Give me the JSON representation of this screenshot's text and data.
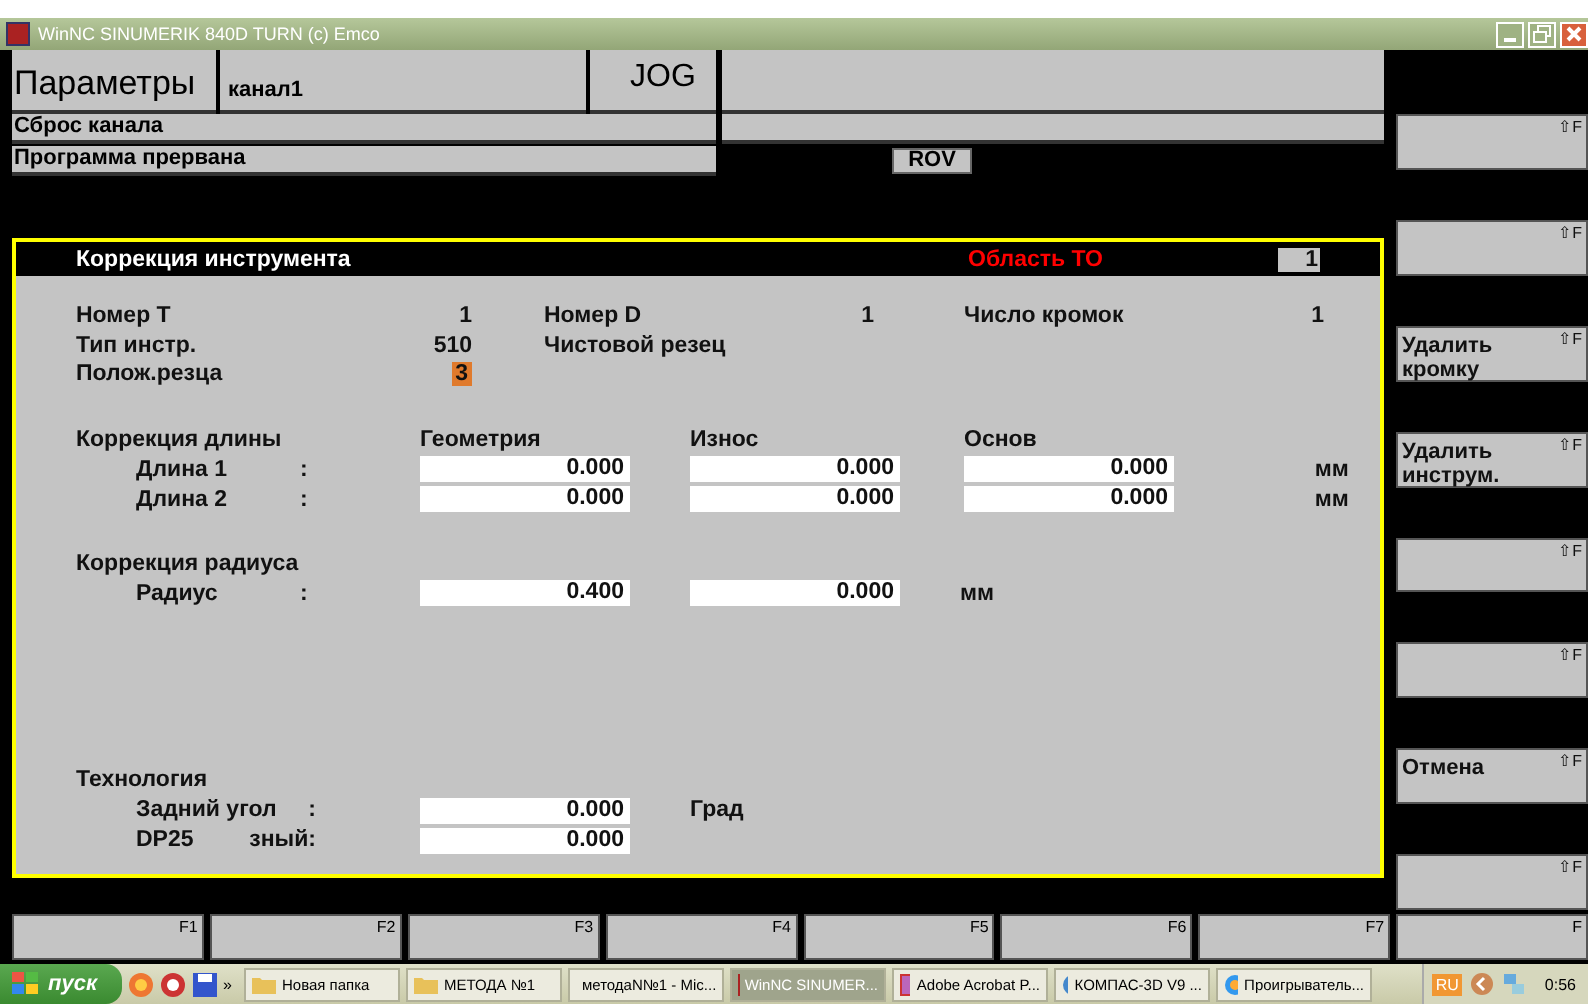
{
  "window": {
    "title": "WinNC SINUMERIK 840D TURN (c) Emco"
  },
  "header": {
    "mode_title": "Параметры",
    "channel": "канал1",
    "mode": "JOG",
    "channel_status": "Сброс канала",
    "program_status": "Программа прервана",
    "override": "ROV"
  },
  "panel": {
    "title": "Коррекция инструмента",
    "area_label": "Область ТО",
    "area_value": "1",
    "info": [
      {
        "label": "Номер T",
        "value": "1",
        "label_2": "Номер D",
        "value_2": "1",
        "label_3": "Число кромок",
        "value_3": "1",
        "focused": false
      },
      {
        "label": "Тип инстр.",
        "value": "510",
        "label_2": "Чистовой резец",
        "focused": false
      },
      {
        "label": "Полож.резца",
        "value": "3",
        "focused": true
      }
    ],
    "length": {
      "heading": "Коррекция длины",
      "columns": [
        "Геометрия",
        "Износ",
        "Основ"
      ],
      "rows": [
        {
          "label": "Длина 1",
          "sep": ":",
          "values": [
            "0.000",
            "0.000",
            "0.000"
          ],
          "unit": "мм"
        },
        {
          "label": "Длина 2",
          "sep": ":",
          "values": [
            "0.000",
            "0.000",
            "0.000"
          ],
          "unit": "мм"
        }
      ]
    },
    "radius": {
      "heading": "Коррекция радиуса",
      "rows": [
        {
          "label": "Радиус",
          "sep": ":",
          "values": [
            "0.400",
            "0.000"
          ],
          "unit": "мм"
        }
      ]
    },
    "technology": {
      "heading": "Технология",
      "rows": [
        {
          "label": "Задний угол",
          "sep": ":",
          "values": [
            "0.000"
          ],
          "unit": "Град"
        },
        {
          "label": "DP25",
          "sep": "зный:",
          "values": [
            "0.000"
          ]
        }
      ]
    }
  },
  "softkeys": [
    {
      "key": "⇧F"
    },
    {
      "key": "⇧F"
    },
    {
      "label": "Удалить кромку",
      "key": "⇧F"
    },
    {
      "label": "Удалить инструм.",
      "key": "⇧F"
    },
    {
      "key": "⇧F"
    },
    {
      "key": "⇧F"
    },
    {
      "label": "Отмена",
      "key": "⇧F"
    },
    {
      "key": "⇧F"
    }
  ],
  "function_keys": [
    "F1",
    "F2",
    "F3",
    "F4",
    "F5",
    "F6",
    "F7",
    "F"
  ],
  "taskbar": {
    "start": "пуск",
    "more": "»",
    "tasks": [
      {
        "label": "Новая папка",
        "selected": false
      },
      {
        "label": "МЕТОДА №1",
        "selected": false
      },
      {
        "label": "методаN№1 - Mic...",
        "selected": false
      },
      {
        "label": "WinNC SINUMER...",
        "selected": true
      },
      {
        "label": "Adobe Acrobat P...",
        "selected": false
      },
      {
        "label": "КОМПАС-3D V9 ...",
        "selected": false
      },
      {
        "label": "Проигрыватель...",
        "selected": false
      }
    ],
    "language": "RU",
    "clock": "0:56"
  }
}
